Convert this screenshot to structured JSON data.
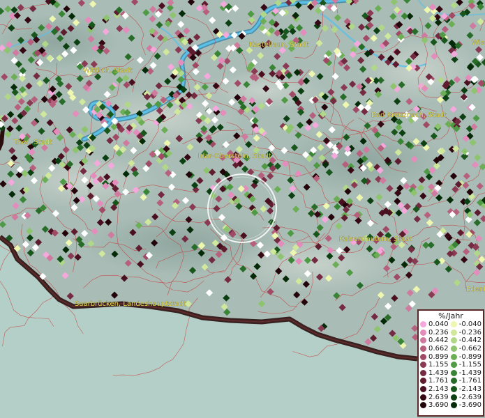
{
  "cities": [
    {
      "id": "kastellaun",
      "label": "Kastellaun, Stadt"
    },
    {
      "id": "wittlich",
      "label": "Wittlich, Stadt"
    },
    {
      "id": "wies",
      "label": "Wies"
    },
    {
      "id": "bad-kreuznach",
      "label": "Bad Kreuznach, Stadt"
    },
    {
      "id": "trier",
      "label": "Trier, Stadt"
    },
    {
      "id": "idar-oberstein",
      "label": "Idar-Oberstein, Stadt"
    },
    {
      "id": "kaiserslautern",
      "label": "Kaiserslautern, Stadt"
    },
    {
      "id": "edenk",
      "label": "Edenk"
    },
    {
      "id": "saarbruecken",
      "label": "Saarbrücken, Landeshauptstadt"
    }
  ],
  "legend": {
    "title": "%/Jahr",
    "positive": [
      {
        "label": "0.040",
        "color": "#f4a8dc"
      },
      {
        "label": "0.236",
        "color": "#e48cbc"
      },
      {
        "label": "0.442",
        "color": "#cf7a9e"
      },
      {
        "label": "0.662",
        "color": "#b7607e"
      },
      {
        "label": "0.899",
        "color": "#a04a66"
      },
      {
        "label": "1.155",
        "color": "#8a3a52"
      },
      {
        "label": "1.439",
        "color": "#742a40"
      },
      {
        "label": "1.761",
        "color": "#5e1c2e"
      },
      {
        "label": "2.143",
        "color": "#4a1020"
      },
      {
        "label": "2.639",
        "color": "#360814"
      },
      {
        "label": "3.690",
        "color": "#22040a"
      }
    ],
    "negative": [
      {
        "label": "-0.040",
        "color": "#eef7b0"
      },
      {
        "label": "-0.236",
        "color": "#cfe89c"
      },
      {
        "label": "-0.442",
        "color": "#b0d888"
      },
      {
        "label": "-0.662",
        "color": "#8ec46e"
      },
      {
        "label": "-0.899",
        "color": "#6cae56"
      },
      {
        "label": "-1.155",
        "color": "#4f9a44"
      },
      {
        "label": "-1.439",
        "color": "#3a8436"
      },
      {
        "label": "-1.761",
        "color": "#276c28"
      },
      {
        "label": "-2.143",
        "color": "#18561c"
      },
      {
        "label": "-2.639",
        "color": "#0c4012"
      },
      {
        "label": "-3.690",
        "color": "#052a08"
      }
    ]
  },
  "colors": {
    "terrain": "#a9bcb6",
    "water": "#4aa8d0",
    "boundaries": "#c83030",
    "border_line": "#2a0e0e",
    "outside_area": "#b4cfc8"
  }
}
